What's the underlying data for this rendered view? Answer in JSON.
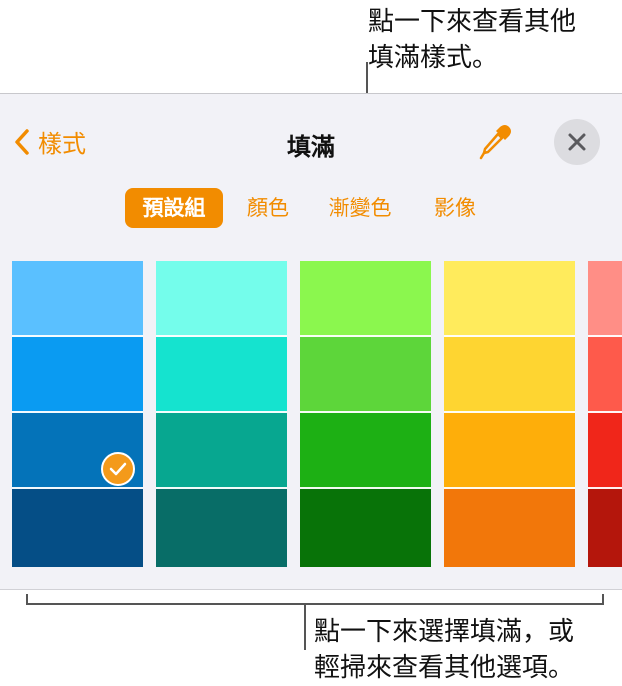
{
  "annotations": {
    "top_line1": "點一下來查看其他",
    "top_line2": "填滿樣式。",
    "bottom_line1": "點一下來選擇填滿，或",
    "bottom_line2": "輕掃來查看其他選項。"
  },
  "header": {
    "back_label": "樣式",
    "title": "填滿"
  },
  "tabs": [
    {
      "label": "預設組",
      "active": true
    },
    {
      "label": "顏色",
      "active": false
    },
    {
      "label": "漸變色",
      "active": false
    },
    {
      "label": "影像",
      "active": false
    }
  ],
  "accent_color": "#F28C00",
  "swatch_columns": [
    {
      "colors": [
        "#5AC0FF",
        "#0A9BF2",
        "#0473B9",
        "#054E86"
      ]
    },
    {
      "colors": [
        "#74FDEB",
        "#15E3CF",
        "#07A790",
        "#086D67"
      ]
    },
    {
      "colors": [
        "#8BF74E",
        "#5DD63A",
        "#1DB014",
        "#087308"
      ]
    },
    {
      "colors": [
        "#FFEB5C",
        "#FED531",
        "#FEAE0A",
        "#F2770A"
      ]
    },
    {
      "colors": [
        "#FF8E86",
        "#FE5A4B",
        "#F0261A",
        "#B4160C"
      ]
    }
  ],
  "selected_swatch": {
    "column": 0,
    "row": 2
  }
}
